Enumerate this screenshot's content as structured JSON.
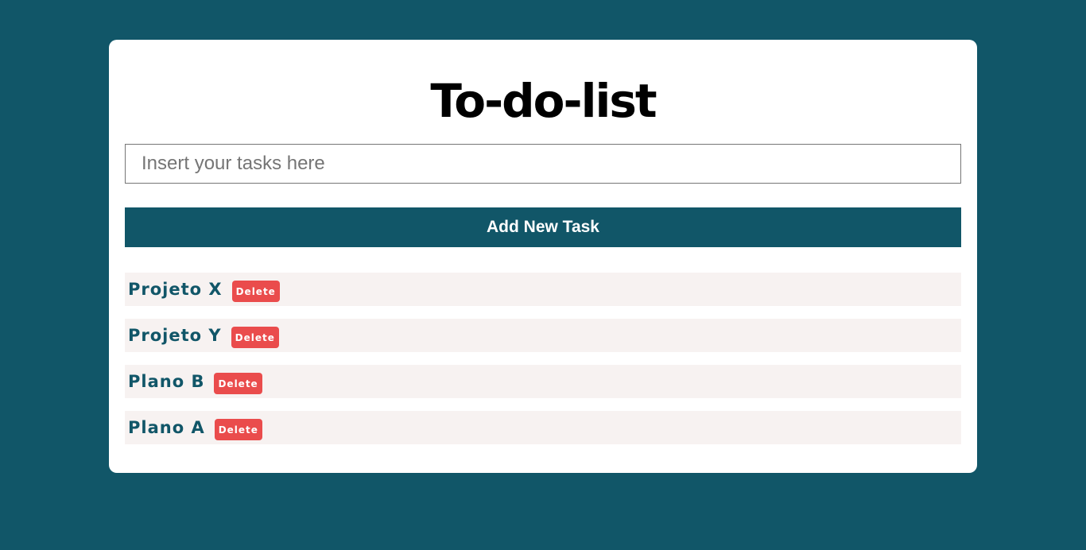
{
  "app": {
    "title": "To-do-list"
  },
  "input": {
    "placeholder": "Insert your tasks here",
    "value": ""
  },
  "add_button": {
    "label": "Add New Task"
  },
  "tasks": [
    {
      "text": "Projeto X",
      "delete_label": "Delete"
    },
    {
      "text": "Projeto Y",
      "delete_label": "Delete"
    },
    {
      "text": "Plano B",
      "delete_label": "Delete"
    },
    {
      "text": "Plano A",
      "delete_label": "Delete"
    }
  ],
  "colors": {
    "background": "#115668",
    "card": "#ffffff",
    "accent": "#115668",
    "task_background": "#f7f2f1",
    "delete": "#ea4c4c"
  }
}
